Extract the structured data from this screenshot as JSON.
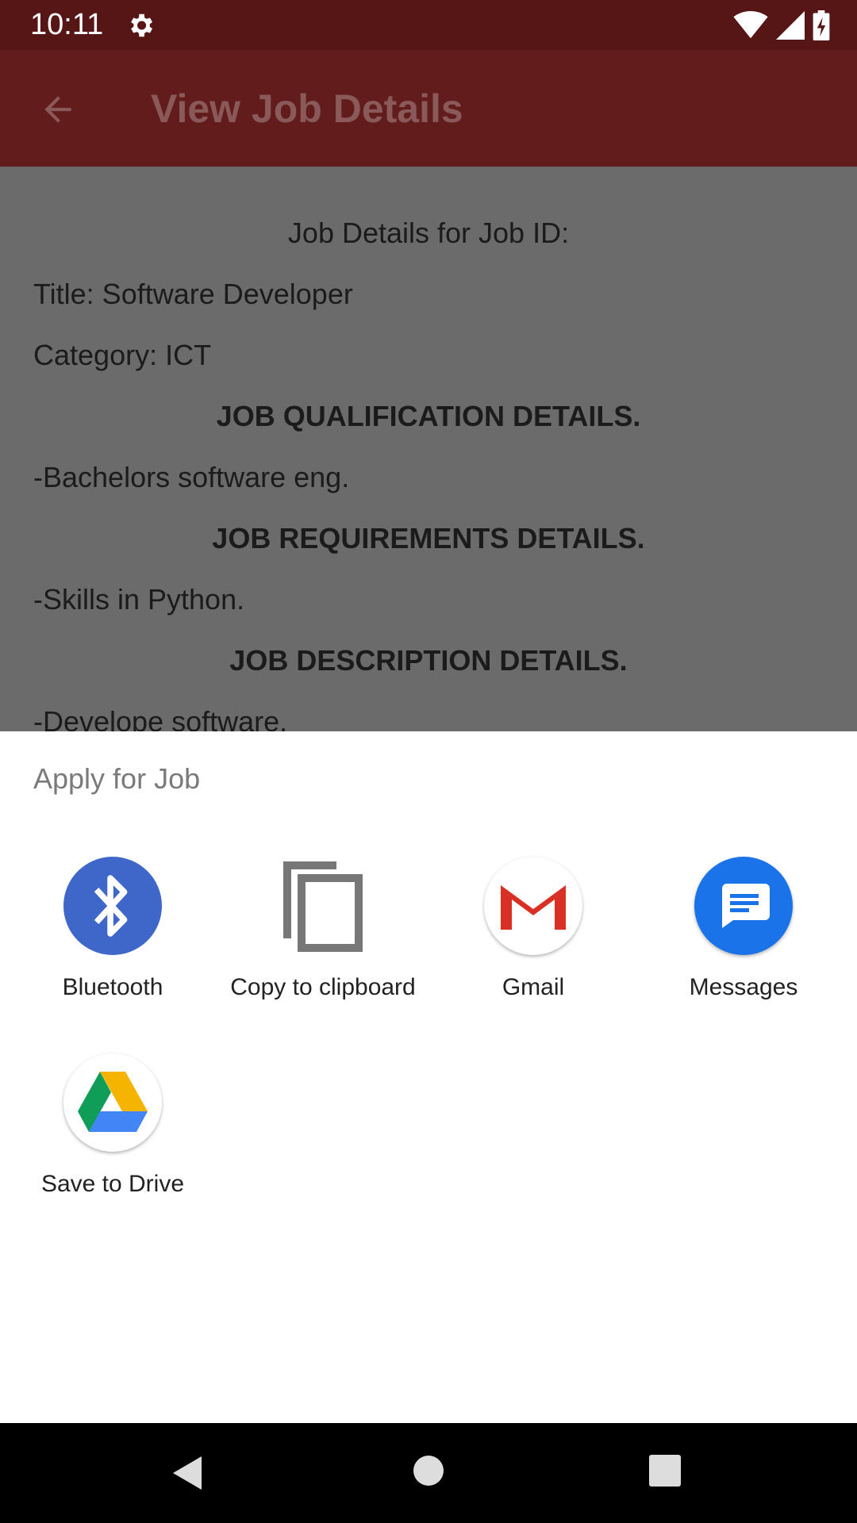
{
  "status_bar": {
    "time": "10:11"
  },
  "app_bar": {
    "title": "View Job Details"
  },
  "content": {
    "heading": "Job Details for Job ID:",
    "title_line": "Title: Software Developer",
    "category_line": "Category: ICT",
    "qualification_header": "JOB QUALIFICATION DETAILS.",
    "qualification_text": "-Bachelors software eng.",
    "requirements_header": "JOB REQUIREMENTS DETAILS.",
    "requirements_text": "-Skills in Python.",
    "description_header": "JOB DESCRIPTION DETAILS.",
    "description_text": "-Develope software."
  },
  "share_sheet": {
    "title": "Apply for Job",
    "targets": [
      {
        "label": "Bluetooth",
        "icon": "bluetooth-icon"
      },
      {
        "label": "Copy to clipboard",
        "icon": "copy-icon"
      },
      {
        "label": "Gmail",
        "icon": "gmail-icon"
      },
      {
        "label": "Messages",
        "icon": "messages-icon"
      },
      {
        "label": "Save to Drive",
        "icon": "drive-icon"
      }
    ]
  },
  "colors": {
    "status_bar": "#561616",
    "app_bar": "#631c1c",
    "scrim_content": "#6b6b6b",
    "bluetooth": "#3f67c9",
    "messages": "#1a73e8"
  }
}
